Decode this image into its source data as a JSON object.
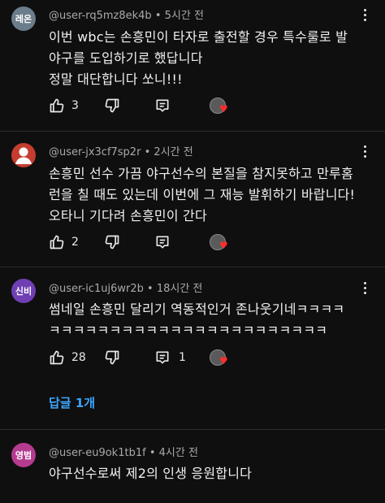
{
  "comments": [
    {
      "avatar_text": "레온",
      "avatar_color": "#6b7c8a",
      "handle": "@user-rq5mz8ek4b",
      "time": "5시간 전",
      "lines": [
        "이번 wbc는 손흥민이 타자로 출전할 경우 특수룰로 발",
        "야구를 도입하기로 했답니다",
        "정말 대단합니다 쏘니!!!"
      ],
      "likes": "3",
      "replies": ""
    },
    {
      "avatar_text": "",
      "avatar_color": "#c43d2f",
      "handle": "@user-jx3cf7sp2r",
      "time": "2시간 전",
      "lines": [
        "손흥민 선수 가끔 야구선수의 본질을 참지못하고 만루홈",
        "런을 칠 때도 있는데 이번에 그 재능 발휘하기 바랍니다!",
        "오타니 기다려 손흥민이 간다"
      ],
      "likes": "2",
      "replies": ""
    },
    {
      "avatar_text": "신비",
      "avatar_color": "#6f3fb3",
      "handle": "@user-ic1uj6wr2b",
      "time": "18시간 전",
      "lines": [
        "썸네일 손흥민 달리기 역동적인거 존나웃기네ㅋㅋㅋㅋ",
        "ㅋㅋㅋㅋㅋㅋㅋㅋㅋㅋㅋㅋㅋㅋㅋㅋㅋㅋㅋㅋㅋㅋㅋ"
      ],
      "likes": "28",
      "replies": "1",
      "reply_link": "답글 1개"
    },
    {
      "avatar_text": "영범",
      "avatar_color": "#b43b8f",
      "handle": "@user-eu9ok1tb1f",
      "time": "4시간 전",
      "lines": [
        "야구선수로써 제2의 인생 응원합니다"
      ]
    }
  ],
  "icons": {
    "like": "thumbs-up-icon",
    "dislike": "thumbs-down-icon",
    "reply": "reply-comment-icon",
    "more": "more-vert-icon",
    "creator_heart": "creator-heart-icon"
  },
  "colors": {
    "background": "#0f0f0f",
    "link": "#3ea6ff",
    "heart": "#ff2d2d"
  }
}
